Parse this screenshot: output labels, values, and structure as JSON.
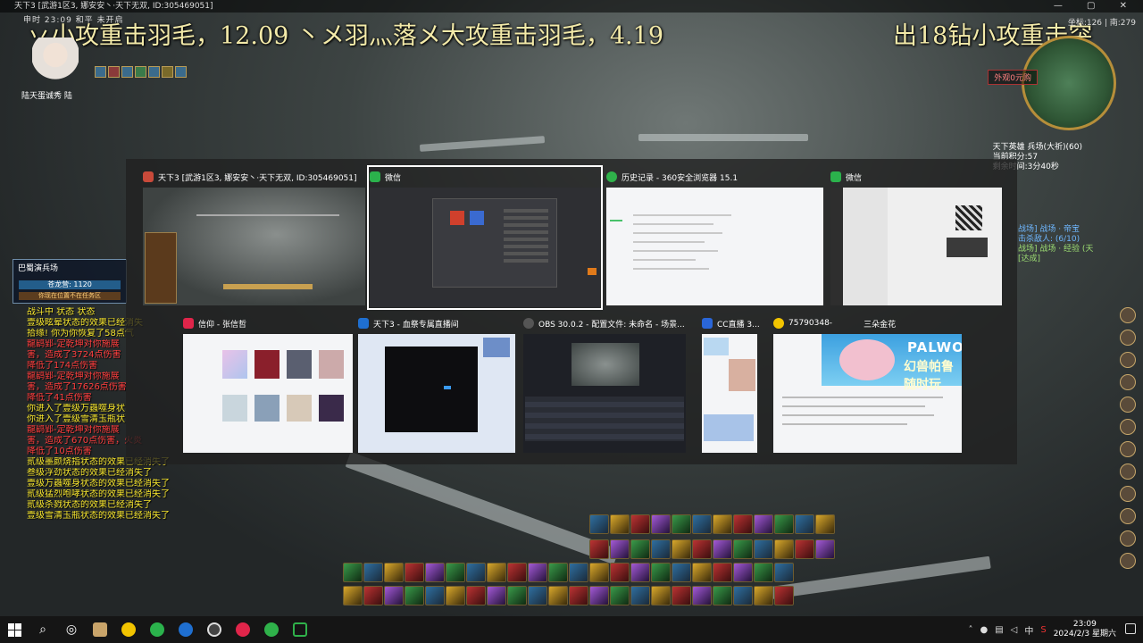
{
  "game": {
    "window_title": "天下3 [武游1区3, 娜安安丶·天下无双, ID:305469051]",
    "stream_banner_left": "丷小攻重击羽毛，12.09 丶メ羽灬落メ大攻重击羽毛，4.19",
    "stream_banner_right": "出18钻小攻重击突",
    "top_info": "申时 23:09      和平      未开启",
    "player_name": "陆天蛋诚秀 陆",
    "map_coords": "坐标:126 | 南:279",
    "appearance_button": "外观0元购",
    "battlefield_info": "天下英雄 兵场(大祈)(60)\n当前积分:57\n剩余时间:3分40秒",
    "side_quest": [
      {
        "text": "战场] 战场 · 帝宝",
        "color": "blue"
      },
      {
        "text": "击杀敌人: (6/10)",
        "color": "blue"
      },
      {
        "text": "战场] 战场 · 经验 (天",
        "color": "green"
      },
      {
        "text": "[达成]",
        "color": "green"
      }
    ],
    "team_panel": {
      "title": "巴蜀演兵场",
      "bar": "苍龙营: 1120",
      "warning": "你现在位置不在任务区"
    },
    "chat": [
      {
        "text": "战斗中 状态 状态",
        "color": "yellow"
      },
      {
        "text": "壹级眩晕状态的效果已经消失",
        "color": "yellow"
      },
      {
        "text": "拾缘! 你为你恢复了58点气",
        "color": "yellow"
      },
      {
        "text": "龍鹞郢-定乾坤对你施展",
        "color": "red"
      },
      {
        "text": "害，造成了3724点伤害",
        "color": "red"
      },
      {
        "text": "降低了174点伤害",
        "color": "red"
      },
      {
        "text": "龍鹞郢-定乾坤对你施展",
        "color": "red"
      },
      {
        "text": "害，造成了17626点伤害",
        "color": "red"
      },
      {
        "text": "降低了41点伤害",
        "color": "red"
      },
      {
        "text": "你进入了壹级万蟲噬身状",
        "color": "yellow"
      },
      {
        "text": "你进入了壹级雪清玉瓶状",
        "color": "yellow"
      },
      {
        "text": "龍鹞郢-定乾坤对你施展",
        "color": "red"
      },
      {
        "text": "害，造成了670点伤害，火炎",
        "color": "red"
      },
      {
        "text": "降低了10点伤害",
        "color": "red"
      },
      {
        "text": "贰级墨颜烧指状态的效果已经消失了",
        "color": "yellow"
      },
      {
        "text": "叁级浮劲状态的效果已经消失了",
        "color": "yellow"
      },
      {
        "text": "壹级万蟲噬身状态的效果已经消失了",
        "color": "yellow"
      },
      {
        "text": "贰级猛烈咆哮状态的效果已经消失了",
        "color": "yellow"
      },
      {
        "text": "贰级杀戮状态的效果已经消失了",
        "color": "yellow"
      },
      {
        "text": "壹级雪清玉瓶状态的效果已经消失了",
        "color": "yellow"
      }
    ]
  },
  "switcher": {
    "windows": [
      {
        "title": "天下3 [武游1区3, 娜安安丶·天下无双, ID:305469051]",
        "icon": "game-icon",
        "kind": "game"
      },
      {
        "title": "微信",
        "icon": "wechat-icon",
        "kind": "dark",
        "selected": true
      },
      {
        "title": "历史记录 - 360安全浏览器 15.1",
        "icon": "browser-icon",
        "kind": "white"
      },
      {
        "title": "微信",
        "icon": "wechat-icon",
        "kind": "wechat"
      },
      {
        "title": "信仰 - 张信哲",
        "icon": "music-icon",
        "kind": "music"
      },
      {
        "title": "天下3 - 血祭专属直播间",
        "icon": "browser-icon",
        "kind": "stream"
      },
      {
        "title": "OBS 30.0.2 - 配置文件: 未命名 - 场景...",
        "icon": "obs-icon",
        "kind": "obs"
      },
      {
        "title": "CC直播 3...",
        "icon": "cc-icon",
        "kind": "cc"
      },
      {
        "title": "75790348-",
        "icon": "qq-icon",
        "kind": "palworld"
      },
      {
        "title": "三朵金花",
        "icon": "",
        "kind": "label"
      }
    ],
    "palworld_logo": "PALWORLD",
    "palworld_sub": "幻兽帕鲁随时玩"
  },
  "taskbar": {
    "apps": [
      "start-icon",
      "search-icon",
      "magnifier-icon",
      "game-app-icon",
      "qq-app-icon",
      "wechat-app-icon",
      "browser-app-icon",
      "obs-app-icon",
      "music-app-icon",
      "360-app-icon",
      "desktop-app-icon"
    ],
    "time": "23:09",
    "date": "2024/2/3 星期六",
    "ime": "中"
  },
  "colors": {
    "banner": "#f3eaa9",
    "chat_yellow": "#f4e32d",
    "chat_red": "#ff3e3e",
    "switcher_bg": "#202020"
  }
}
